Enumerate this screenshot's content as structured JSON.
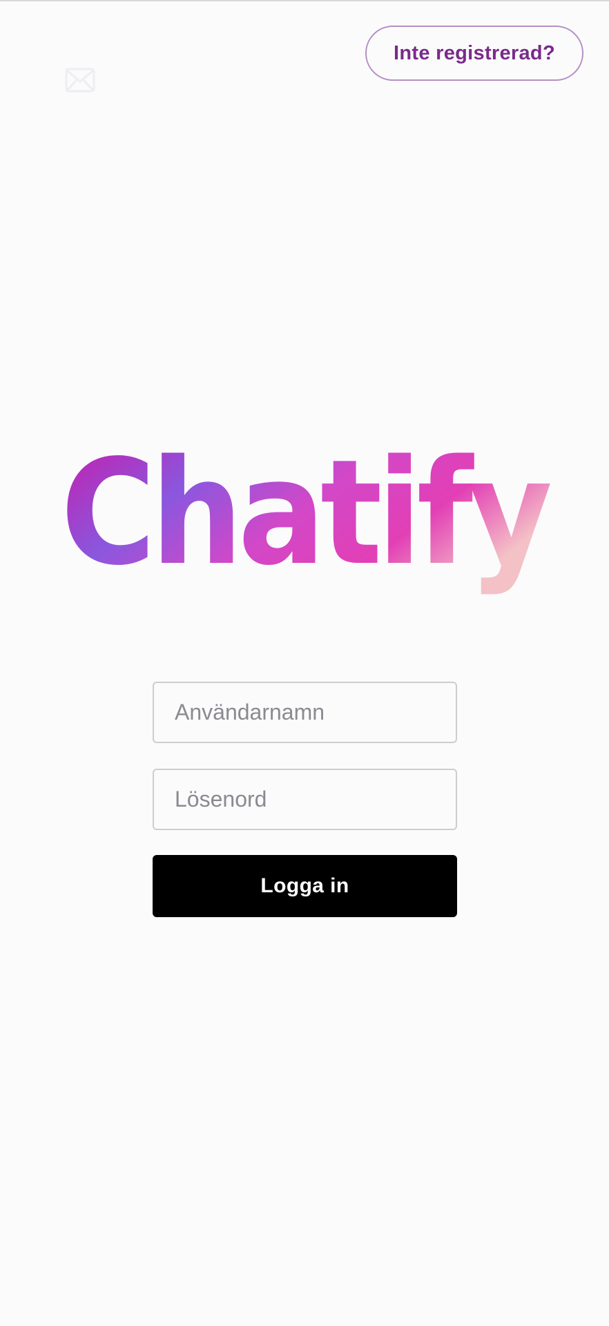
{
  "header": {
    "icon": "mail-icon",
    "register_label": "Inte registrerad?"
  },
  "logo": {
    "text": "Chatify",
    "colors": [
      "#c41fae",
      "#8a57de",
      "#e23fb5",
      "#f4c1c6"
    ]
  },
  "form": {
    "username": {
      "value": "",
      "placeholder": "Användarnamn"
    },
    "password": {
      "value": "",
      "placeholder": "Lösenord"
    },
    "login_label": "Logga in"
  },
  "colors": {
    "background": "#fbfbfc",
    "accent": "#7a2a8a",
    "button": "#000000"
  }
}
